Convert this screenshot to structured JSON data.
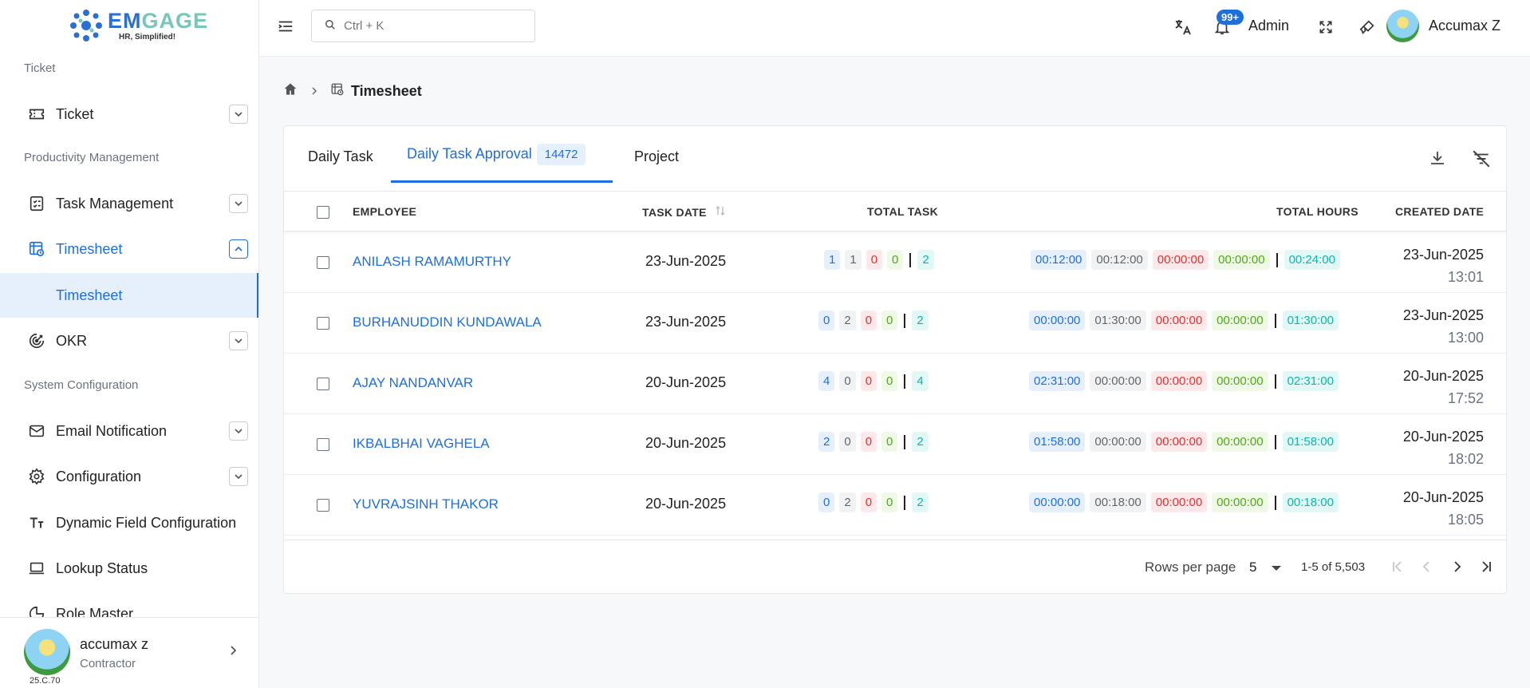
{
  "brand": {
    "name_part1": "EM",
    "name_part2": "GAGE",
    "tagline": "HR, Simplified!"
  },
  "sidebar": {
    "sections": [
      {
        "label": "Ticket"
      },
      {
        "label": "Productivity Management"
      },
      {
        "label": "System Configuration"
      }
    ],
    "items": [
      {
        "label": "Ticket",
        "icon": "ticket-icon"
      },
      {
        "label": "Task Management",
        "icon": "checklist-icon"
      },
      {
        "label": "Timesheet",
        "icon": "timesheet-icon"
      },
      {
        "label": "Timesheet"
      },
      {
        "label": "OKR",
        "icon": "target-icon"
      },
      {
        "label": "Email Notification",
        "icon": "mail-icon"
      },
      {
        "label": "Configuration",
        "icon": "gear-icon"
      },
      {
        "label": "Dynamic Field Configuration",
        "icon": "text-size-icon"
      },
      {
        "label": "Lookup Status",
        "icon": "laptop-icon"
      },
      {
        "label": "Role Master",
        "icon": "role-icon"
      }
    ],
    "user": {
      "name": "accumax z",
      "role": "Contractor",
      "version": "25.C.70"
    }
  },
  "header": {
    "search_placeholder": "Ctrl + K",
    "notification_count": "99+",
    "role_label": "Admin",
    "user_name": "Accumax Z"
  },
  "breadcrumb": {
    "title": "Timesheet"
  },
  "tabs": [
    {
      "label": "Daily Task"
    },
    {
      "label": "Daily Task Approval",
      "count": "14472"
    },
    {
      "label": "Project"
    }
  ],
  "table": {
    "headers": {
      "employee": "EMPLOYEE",
      "task_date": "TASK DATE",
      "total_task": "TOTAL TASK",
      "total_hours": "TOTAL HOURS",
      "created_date": "CREATED DATE"
    },
    "rows": [
      {
        "employee": "ANILASH RAMAMURTHY",
        "task_date": "23-Jun-2025",
        "tasks": [
          "1",
          "1",
          "0",
          "0",
          "2"
        ],
        "hours": [
          "00:12:00",
          "00:12:00",
          "00:00:00",
          "00:00:00",
          "00:24:00"
        ],
        "created_date": "23-Jun-2025",
        "created_time": "13:01"
      },
      {
        "employee": "BURHANUDDIN KUNDAWALA",
        "task_date": "23-Jun-2025",
        "tasks": [
          "0",
          "2",
          "0",
          "0",
          "2"
        ],
        "hours": [
          "00:00:00",
          "01:30:00",
          "00:00:00",
          "00:00:00",
          "01:30:00"
        ],
        "created_date": "23-Jun-2025",
        "created_time": "13:00"
      },
      {
        "employee": "AJAY NANDANVAR",
        "task_date": "20-Jun-2025",
        "tasks": [
          "4",
          "0",
          "0",
          "0",
          "4"
        ],
        "hours": [
          "02:31:00",
          "00:00:00",
          "00:00:00",
          "00:00:00",
          "02:31:00"
        ],
        "created_date": "20-Jun-2025",
        "created_time": "17:52"
      },
      {
        "employee": "IKBALBHAI VAGHELA",
        "task_date": "20-Jun-2025",
        "tasks": [
          "2",
          "0",
          "0",
          "0",
          "2"
        ],
        "hours": [
          "01:58:00",
          "00:00:00",
          "00:00:00",
          "00:00:00",
          "01:58:00"
        ],
        "created_date": "20-Jun-2025",
        "created_time": "18:02"
      },
      {
        "employee": "YUVRAJSINH THAKOR",
        "task_date": "20-Jun-2025",
        "tasks": [
          "0",
          "2",
          "0",
          "0",
          "2"
        ],
        "hours": [
          "00:00:00",
          "00:18:00",
          "00:00:00",
          "00:00:00",
          "00:18:00"
        ],
        "created_date": "20-Jun-2025",
        "created_time": "18:05"
      }
    ]
  },
  "pagination": {
    "rows_per_page_label": "Rows per page",
    "rows_per_page": "5",
    "range": "1-5 of 5,503"
  },
  "colors": {
    "accent": "#1e6fdc",
    "brand_teal": "#76c7b7"
  }
}
